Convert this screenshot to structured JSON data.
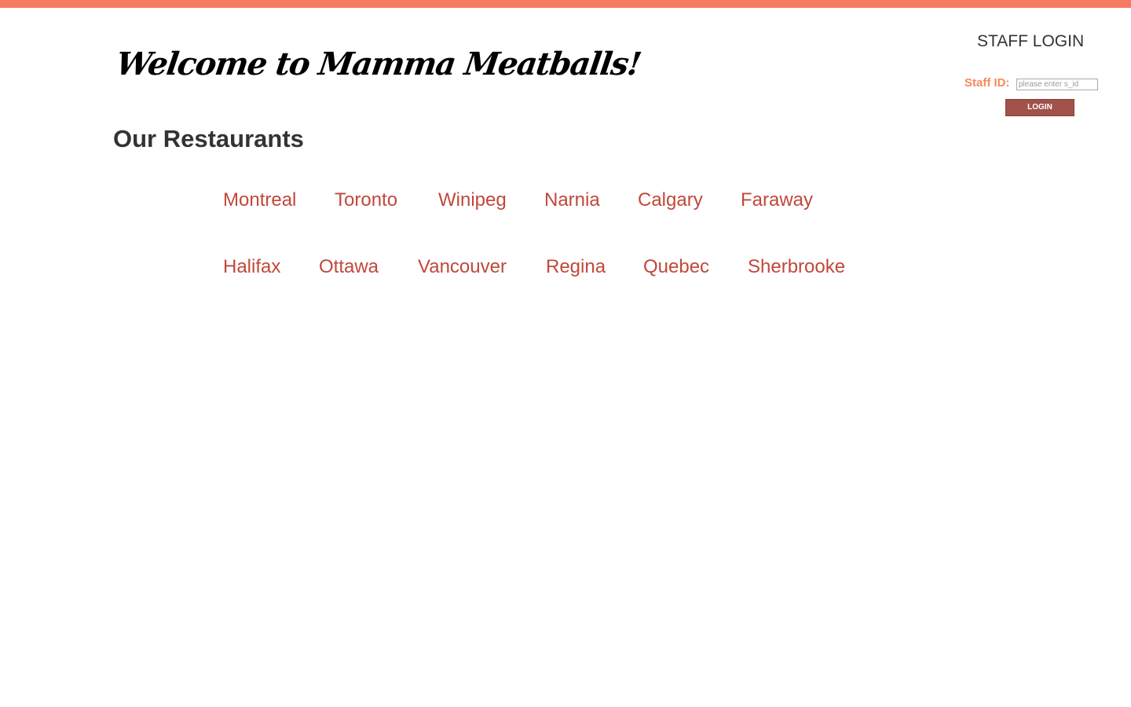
{
  "header": {
    "site_title": "Welcome to Mamma Meatballs!",
    "accent_color": "#f57c62"
  },
  "staff_login": {
    "heading": "STAFF LOGIN",
    "id_label": "Staff ID:",
    "id_placeholder": "please enter s_id",
    "id_value": "",
    "button_label": "LOGIN"
  },
  "restaurants": {
    "section_title": "Our Restaurants",
    "link_color": "#c0483a",
    "rows": [
      [
        "Montreal",
        "Toronto",
        "Winipeg",
        "Narnia",
        "Calgary",
        "Faraway"
      ],
      [
        "Halifax",
        "Ottawa",
        "Vancouver",
        "Regina",
        "Quebec",
        "Sherbrooke"
      ]
    ]
  }
}
